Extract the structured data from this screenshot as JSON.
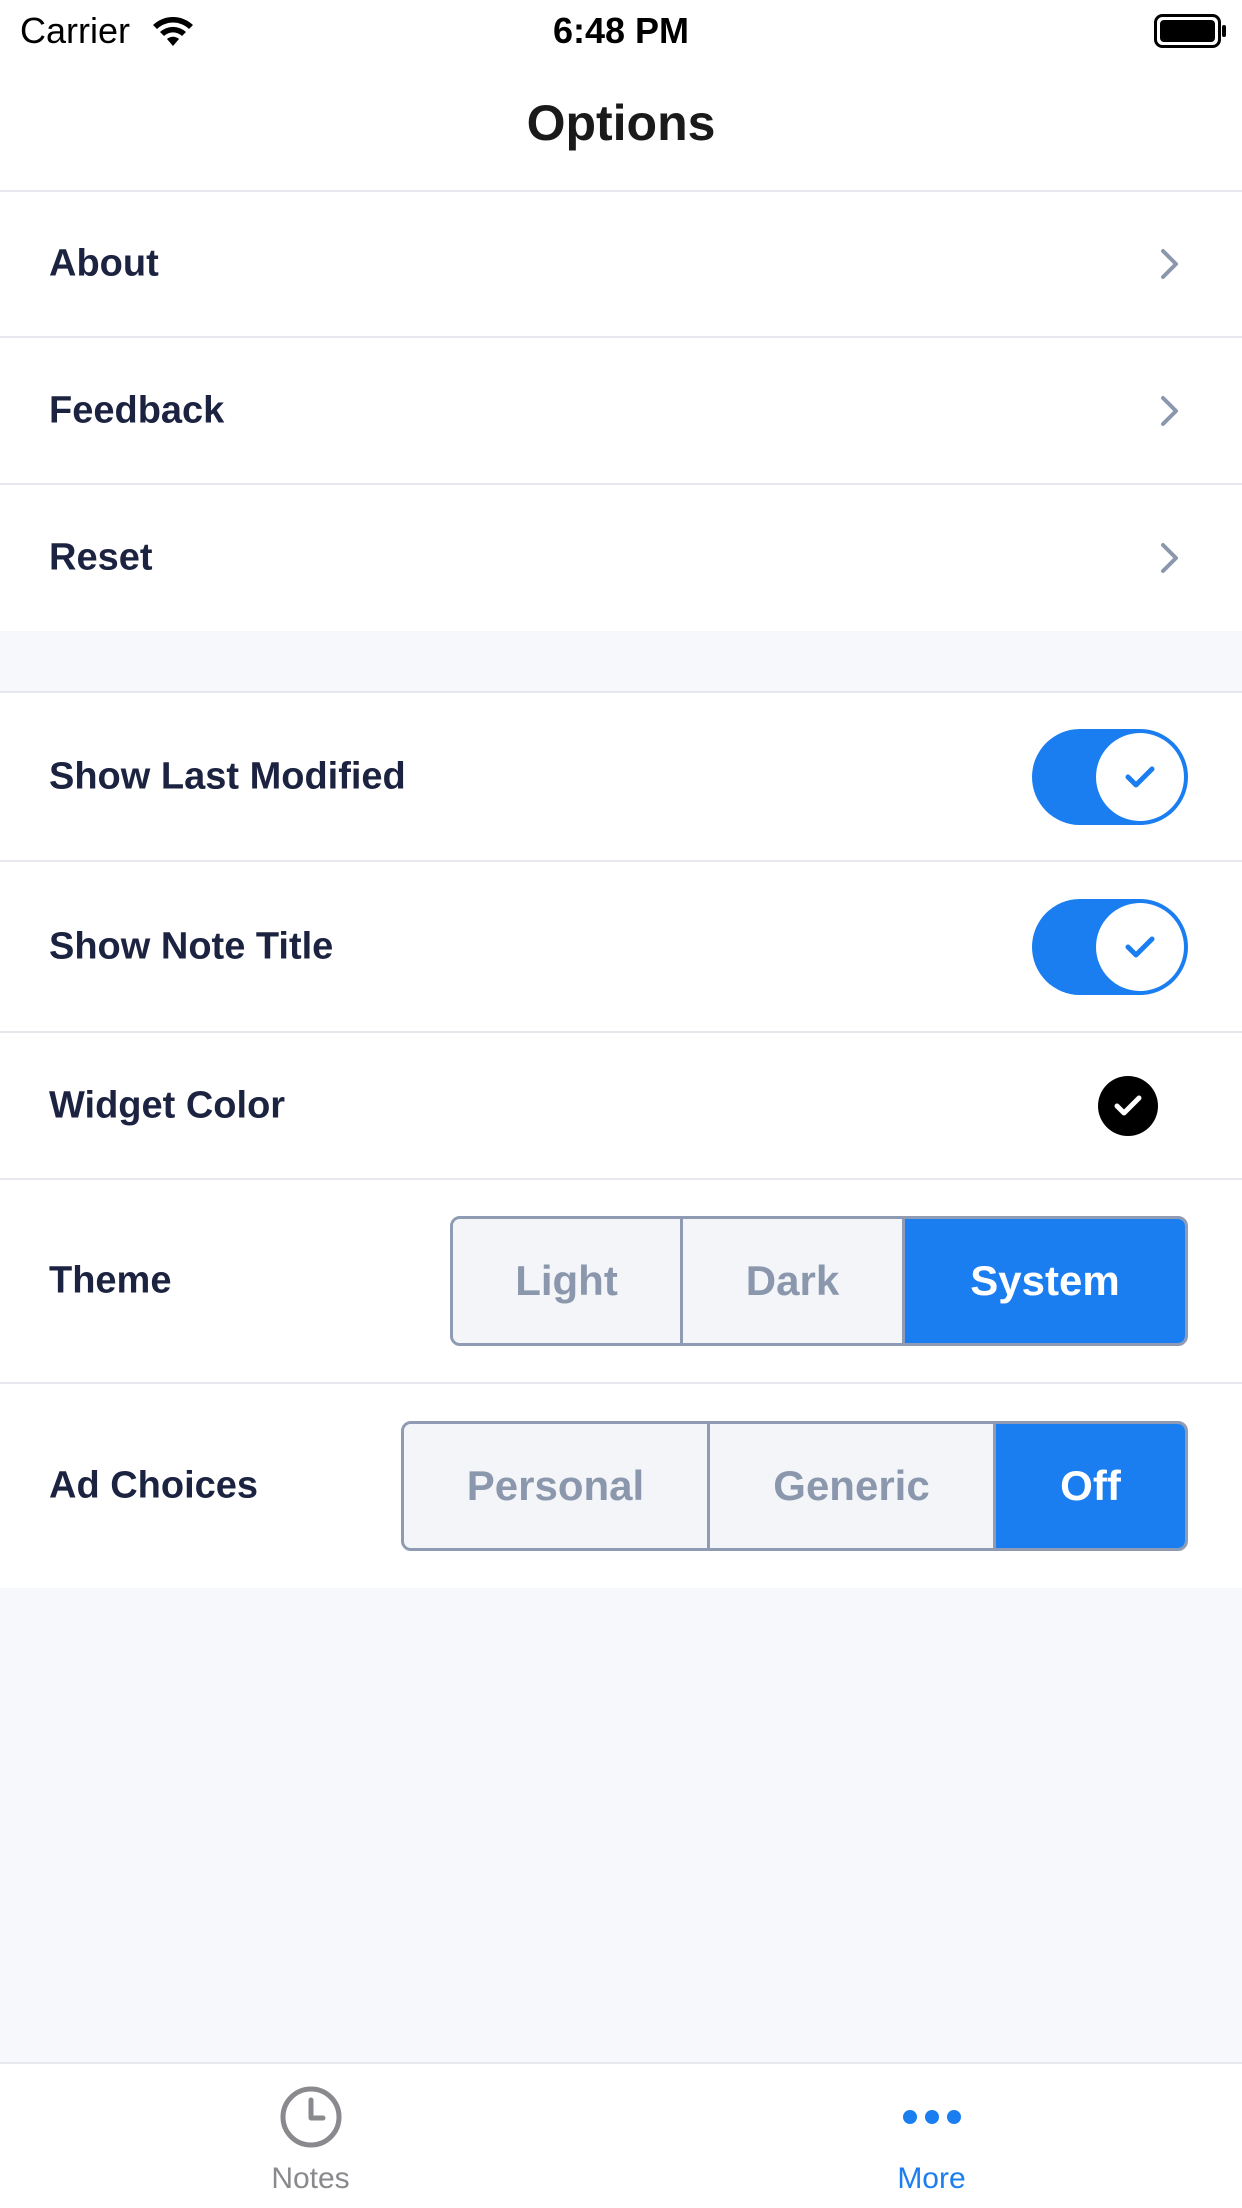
{
  "status_bar": {
    "carrier": "Carrier",
    "time": "6:48 PM"
  },
  "nav": {
    "title": "Options"
  },
  "menu_rows": [
    {
      "label": "About"
    },
    {
      "label": "Feedback"
    },
    {
      "label": "Reset"
    }
  ],
  "settings": {
    "show_last_modified": {
      "label": "Show Last Modified",
      "enabled": true
    },
    "show_note_title": {
      "label": "Show Note Title",
      "enabled": true
    },
    "widget_color": {
      "label": "Widget Color",
      "color": "#000000"
    },
    "theme": {
      "label": "Theme",
      "options": [
        "Light",
        "Dark",
        "System"
      ],
      "selected": "System"
    },
    "ad_choices": {
      "label": "Ad Choices",
      "options": [
        "Personal",
        "Generic",
        "Off"
      ],
      "selected": "Off"
    }
  },
  "tab_bar": {
    "tabs": [
      {
        "label": "Notes",
        "icon": "clock-icon",
        "selected": false
      },
      {
        "label": "More",
        "icon": "more-dots-icon",
        "selected": true
      }
    ]
  },
  "colors": {
    "accent": "#1b7ef0",
    "text": "#1c2340",
    "inactive": "#8b97ad",
    "background": "#f7f8fb"
  }
}
